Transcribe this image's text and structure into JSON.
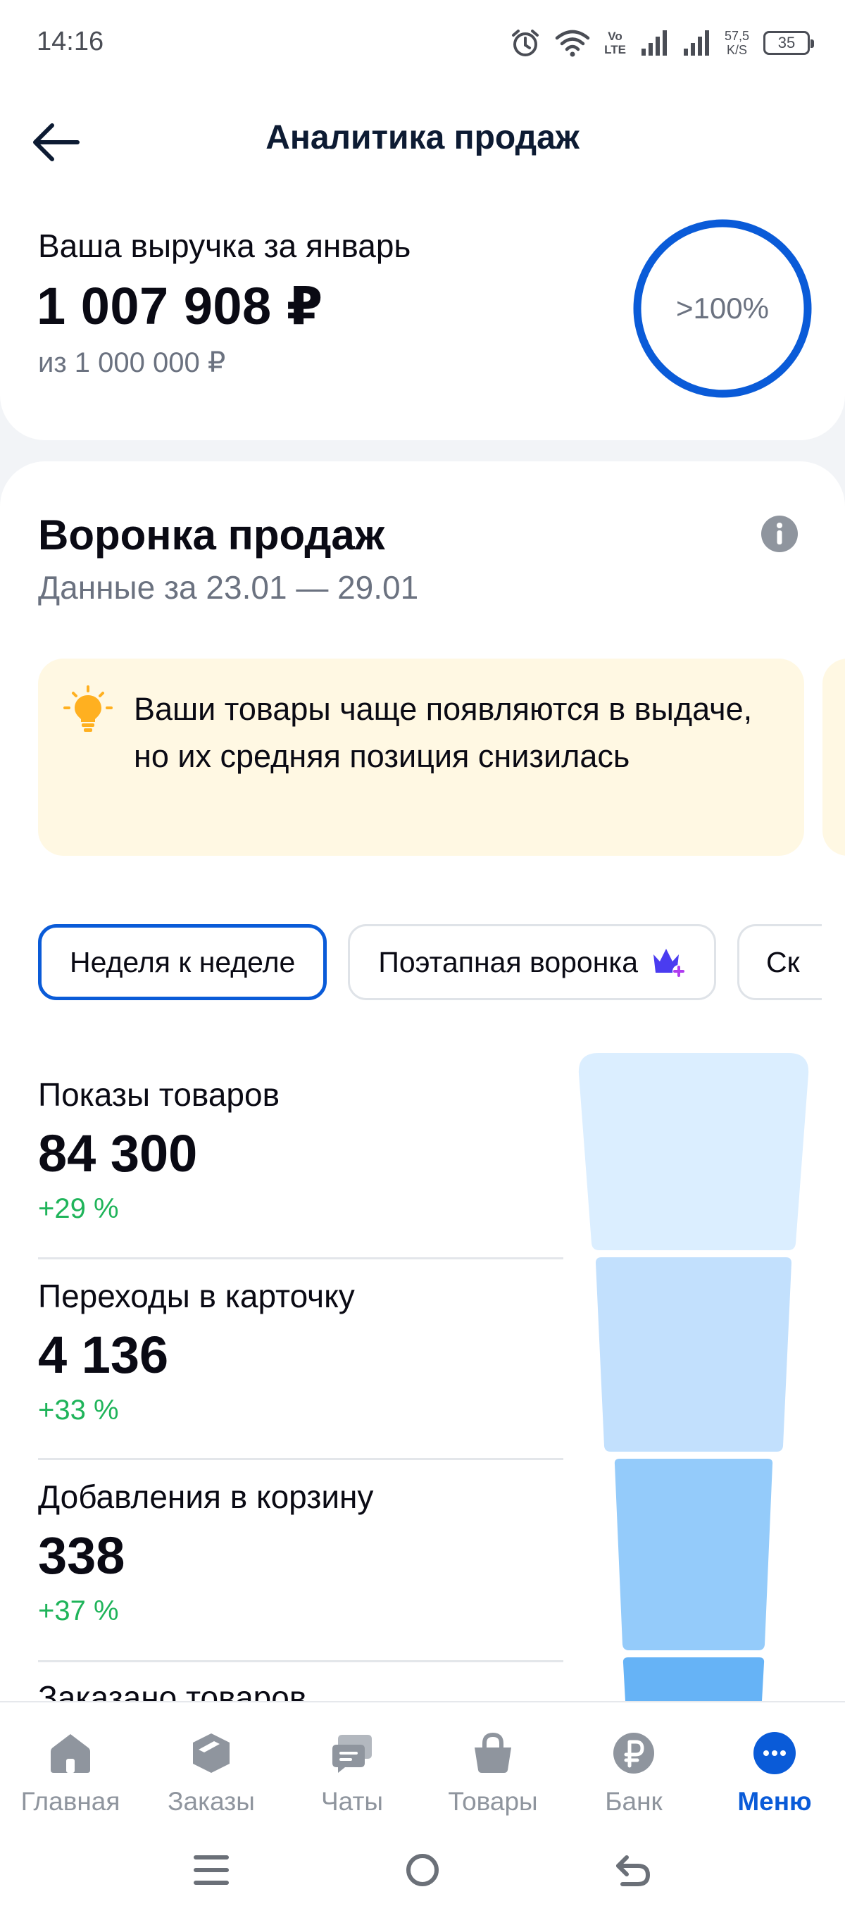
{
  "status_bar": {
    "time": "14:16",
    "lte_line1": "Vo",
    "lte_line2": "LTE",
    "speed_line1": "57,5",
    "speed_line2": "K/S",
    "battery": "35"
  },
  "header": {
    "title": "Аналитика продаж"
  },
  "revenue": {
    "label": "Ваша выручка за январь",
    "value": "1 007 908 ₽",
    "target": "из 1 000 000 ₽",
    "progress_text": ">100%",
    "progress_fraction": 1.0
  },
  "funnel": {
    "title": "Воронка продаж",
    "subtitle": "Данные за 23.01 — 29.01",
    "tip": "Ваши товары чаще появляются в выдаче, но их средняя позиция снизилась",
    "chips": [
      {
        "label": "Неделя к неделе",
        "active": true
      },
      {
        "label": "Поэтапная воронка",
        "active": false,
        "icon": "crown-plus-icon"
      },
      {
        "label": "Ск",
        "active": false
      }
    ],
    "metrics": [
      {
        "label": "Показы товаров",
        "value": "84 300",
        "delta": "+29 %"
      },
      {
        "label": "Переходы в карточку",
        "value": "4 136",
        "delta": "+33 %"
      },
      {
        "label": "Добавления в корзину",
        "value": "338",
        "delta": "+37 %"
      },
      {
        "label": "Заказано товаров"
      }
    ],
    "bar_colors": [
      "#dbeeff",
      "#c2e0fd",
      "#94cbfa",
      "#66b3f6"
    ]
  },
  "bottom_nav": {
    "items": [
      {
        "label": "Главная",
        "icon": "home-icon"
      },
      {
        "label": "Заказы",
        "icon": "box-icon"
      },
      {
        "label": "Чаты",
        "icon": "chat-icon"
      },
      {
        "label": "Товары",
        "icon": "basket-icon"
      },
      {
        "label": "Банк",
        "icon": "ruble-icon"
      },
      {
        "label": "Меню",
        "icon": "menu-dots-icon",
        "active": true
      }
    ]
  },
  "colors": {
    "accent": "#0a5bd8",
    "positive": "#1fb45a",
    "muted_text": "#6b7280",
    "tip_bg": "#fff8e3"
  }
}
